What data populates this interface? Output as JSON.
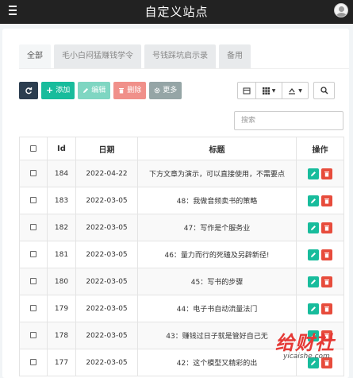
{
  "app": {
    "title": "自定义站点"
  },
  "tabs": [
    {
      "label": "全部",
      "active": true
    },
    {
      "label": "毛小白闷猛赚钱学令",
      "active": false
    },
    {
      "label": "号钱踩坑启示录",
      "active": false
    },
    {
      "label": "备用",
      "active": false
    }
  ],
  "toolbar": {
    "add_label": "添加",
    "edit_label": "编辑",
    "delete_label": "删除",
    "more_label": "更多"
  },
  "search": {
    "placeholder": "搜索",
    "value": ""
  },
  "table": {
    "columns": [
      "",
      "Id",
      "日期",
      "标题",
      "操作"
    ],
    "rows": [
      {
        "id": "184",
        "date": "2022-04-22",
        "title": "下方文章为演示，可以直接使用，不需要点"
      },
      {
        "id": "183",
        "date": "2022-03-05",
        "title": "48：我做音频卖书的策略"
      },
      {
        "id": "182",
        "date": "2022-03-05",
        "title": "47：写作是个服务业"
      },
      {
        "id": "181",
        "date": "2022-03-05",
        "title": "46：量力而行的死磕及另辟新径!"
      },
      {
        "id": "180",
        "date": "2022-03-05",
        "title": "45：写书的步骤"
      },
      {
        "id": "179",
        "date": "2022-03-05",
        "title": "44：电子书自动流量法门"
      },
      {
        "id": "178",
        "date": "2022-03-05",
        "title": "43：赚钱过日子就是管好自己无"
      },
      {
        "id": "177",
        "date": "2022-03-05",
        "title": "42：这个模型又精彩的出"
      }
    ]
  },
  "watermark": {
    "big": "给财社",
    "small": "yicaishe.com"
  },
  "colors": {
    "topbar": "#222222",
    "primary": "#18bc9c",
    "danger": "#e74c3c",
    "dark": "#2c3e50"
  }
}
